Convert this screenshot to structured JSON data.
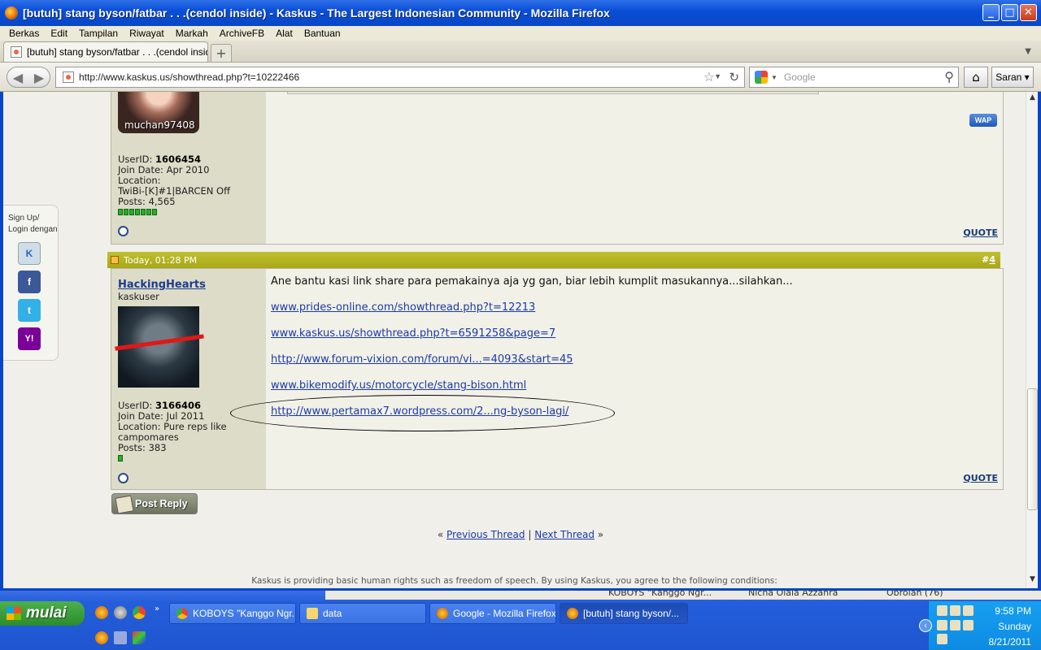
{
  "window": {
    "title": "[butuh] stang byson/fatbar . . .(cendol inside) - Kaskus - The Largest Indonesian Community - Mozilla Firefox"
  },
  "menu": [
    "Berkas",
    "Edit",
    "Tampilan",
    "Riwayat",
    "Markah",
    "ArchiveFB",
    "Alat",
    "Bantuan"
  ],
  "tab": {
    "title": "[butuh] stang byson/fatbar . . .(cendol insid..."
  },
  "nav": {
    "url": "http://www.kaskus.us/showthread.php?t=10222466",
    "search_placeholder": "Google",
    "saran": "Saran"
  },
  "sidepanel": {
    "label_line1": "Sign Up/",
    "label_line2": "Login dengan",
    "btn_kaskus": "K",
    "btn_facebook": "f",
    "btn_twitter": "t",
    "btn_yahoo": "Y!"
  },
  "post1": {
    "avatar_text": "muchan97408",
    "userid_label": "UserID:",
    "userid": "1606454",
    "join": "Join Date: Apr 2010",
    "location_label": "Location:",
    "location": "TwiBi-[K]#1|BARCEN Off",
    "posts": "Posts: 4,565",
    "quote": "QUOTE",
    "wap": "WAP"
  },
  "post2": {
    "date": "Today, 01:28 PM",
    "num_prefix": "#",
    "num": "4",
    "username": "HackingHearts",
    "user_title": "kaskuser",
    "userid_label": "UserID:",
    "userid": "3166406",
    "join": "Join Date: Jul 2011",
    "location1": "Location: Pure reps like",
    "location2": "campomares",
    "posts": "Posts: 383",
    "message": "Ane bantu kasi link share para pemakainya aja yg gan, biar lebih kumplit masukannya...silahkan...",
    "links": [
      "www.prides-online.com/showthread.php?t=12213",
      "www.kaskus.us/showthread.php?t=6591258&page=7",
      "http://www.forum-vixion.com/forum/vi...=4093&start=45",
      "www.bikemodify.us/motorcycle/stang-bison.html",
      "http://www.pertamax7.wordpress.com/2...ng-byson-lagi/"
    ],
    "quote": "QUOTE"
  },
  "post_reply": "Post Reply",
  "threadnav": {
    "open": "«",
    "prev": "Previous Thread",
    "sep": "|",
    "next": "Next Thread",
    "close": "»"
  },
  "footer": "Kaskus is providing basic human rights such as freedom of speech. By using Kaskus, you agree to the following conditions:",
  "underbar": {
    "item1": "KOBOYS \"Kanggo Ngr...",
    "item2": "Nicha Olala Azzahra",
    "item3": "Obrolan (76)"
  },
  "taskbar": {
    "start": "mulai",
    "tasks": [
      "KOBOYS \"Kanggo Ngr...",
      "data",
      "Google - Mozilla Firefox",
      "[butuh] stang byson/..."
    ],
    "time": "9:58 PM",
    "day": "Sunday",
    "date": "8/21/2011"
  }
}
